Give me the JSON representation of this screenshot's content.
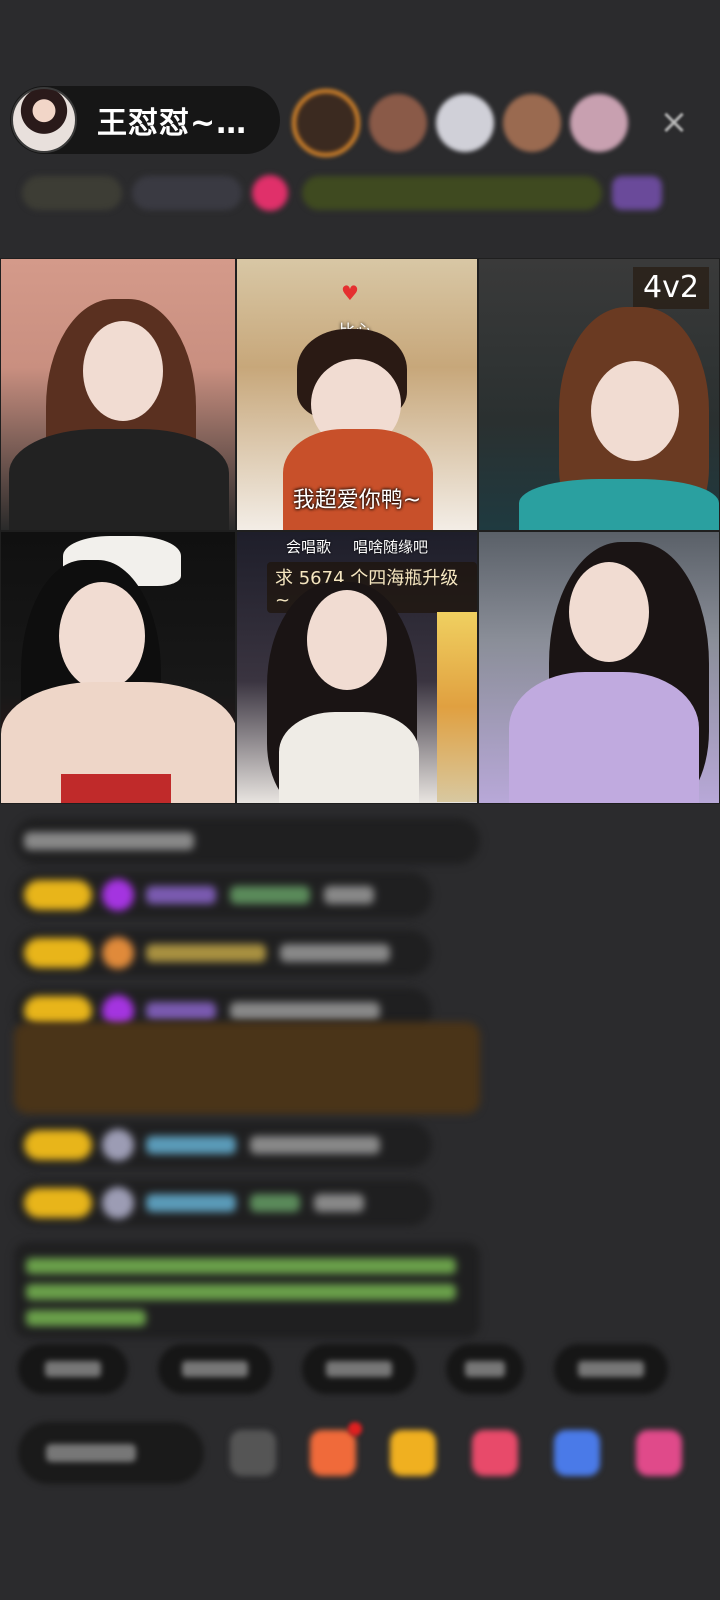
{
  "header": {
    "host_name": "王怼怼~…",
    "close_icon": "close-icon"
  },
  "grid": {
    "tile2": {
      "heart_label": "比心",
      "caption": "我超爱你鸭~"
    },
    "tile3": {
      "mode_badge": "4v2"
    },
    "tile5": {
      "tip_left": "会唱歌",
      "tip_right": "唱啥随缘吧",
      "tip_main": "求 5674 个四海瓶升级~"
    }
  },
  "colors": {
    "background": "#2b2b2d",
    "level_badge": "#e8b51a",
    "gift_bubble": "#4a3418"
  }
}
